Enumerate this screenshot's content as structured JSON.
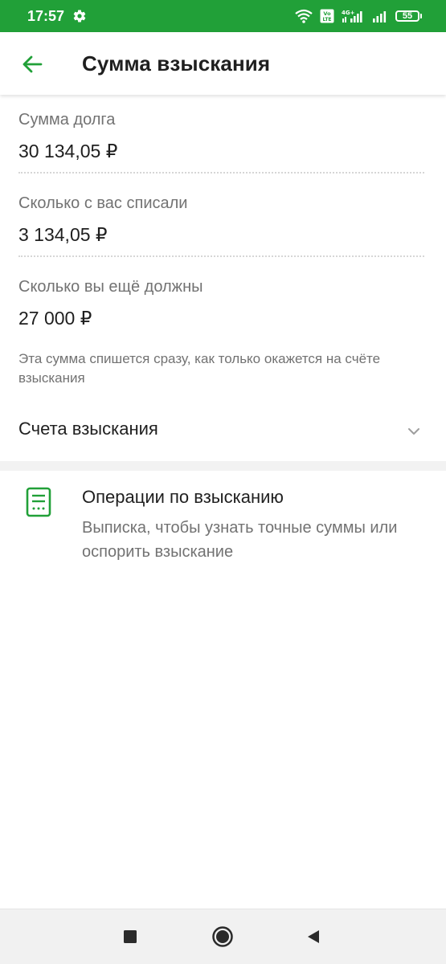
{
  "status_bar": {
    "time": "17:57",
    "battery_level": "55",
    "network": "4G+",
    "volte": "Vo LTE",
    "background_color": "#21a038"
  },
  "app_bar": {
    "title": "Сумма взыскания",
    "back_icon": "arrow-back-icon",
    "accent_color": "#21a038"
  },
  "fields": [
    {
      "label": "Сумма долга",
      "value": "30 134,05 ₽"
    },
    {
      "label": "Сколько с вас списали",
      "value": "3 134,05 ₽"
    },
    {
      "label": "Сколько вы ещё должны",
      "value": "27 000 ₽"
    }
  ],
  "note": "Эта сумма спишется сразу, как только окажется на счёте взыскания",
  "accounts_section": {
    "label": "Счета взыскания",
    "icon": "chevron-down-icon"
  },
  "operations": {
    "title": "Операции по взысканию",
    "subtitle": "Выписка, чтобы узнать точные суммы или оспорить взыскание",
    "icon": "document-list-icon"
  },
  "nav_bar": {
    "recents_icon": "square-icon",
    "home_icon": "circle-icon",
    "back_icon": "triangle-back-icon"
  }
}
